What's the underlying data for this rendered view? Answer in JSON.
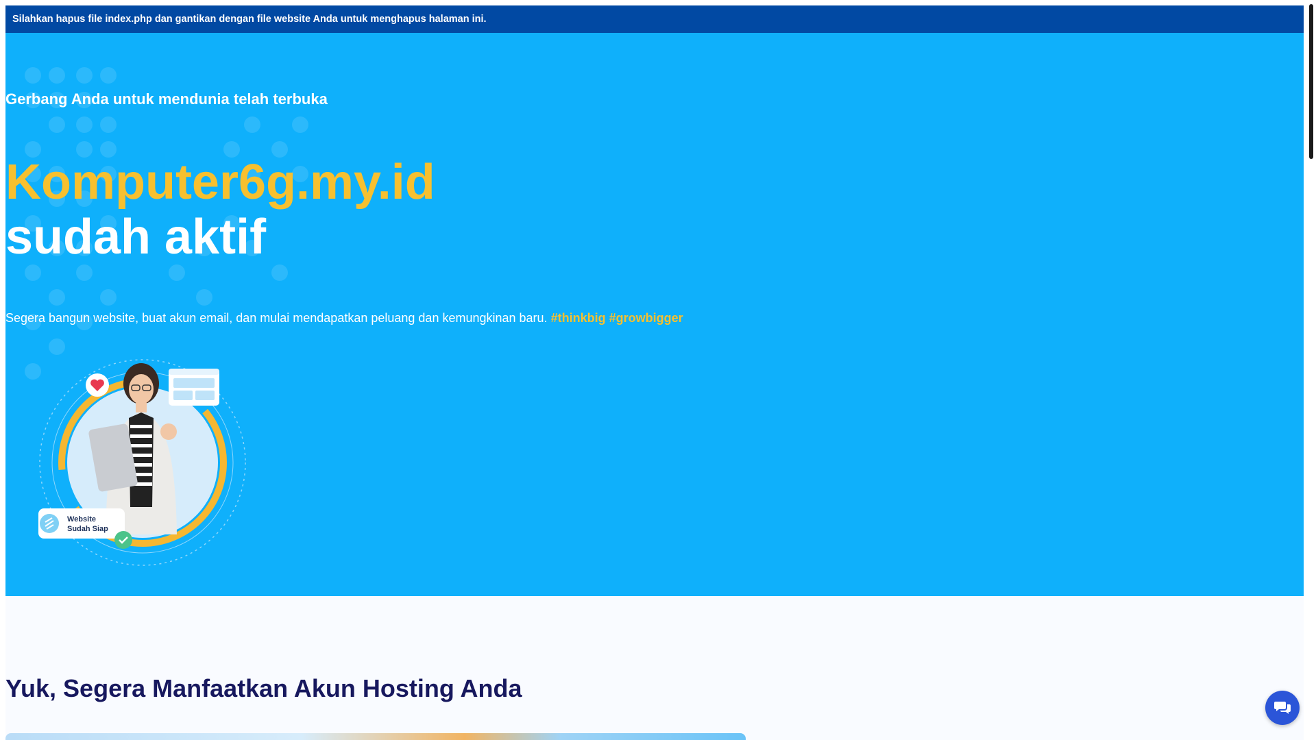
{
  "notice": {
    "text": "Silahkan hapus file index.php dan gantikan dengan file website Anda untuk menghapus halaman ini."
  },
  "hero": {
    "tagline": "Gerbang Anda untuk mendunia telah terbuka",
    "domain": "Komputer6g.my.id",
    "status": "sudah aktif",
    "description": "Segera bangun website, buat akun email, dan mulai mendapatkan peluang dan kemungkinan baru.",
    "hashtags": "#thinkbig #growbigger",
    "illustration": {
      "badge_line1": "Website",
      "badge_line2": "Sudah Siap",
      "icons": [
        "heart-icon",
        "browser-window-icon",
        "check-icon",
        "link-icon"
      ]
    }
  },
  "section": {
    "title": "Yuk, Segera Manfaatkan Akun Hosting Anda"
  },
  "chat": {
    "icon": "chat-bubbles-icon"
  },
  "colors": {
    "notice_bg": "#0149a3",
    "hero_bg": "#0fb0fb",
    "accent_yellow": "#f7c02f",
    "section_title": "#17185e",
    "chat_button": "#2b55d8"
  }
}
